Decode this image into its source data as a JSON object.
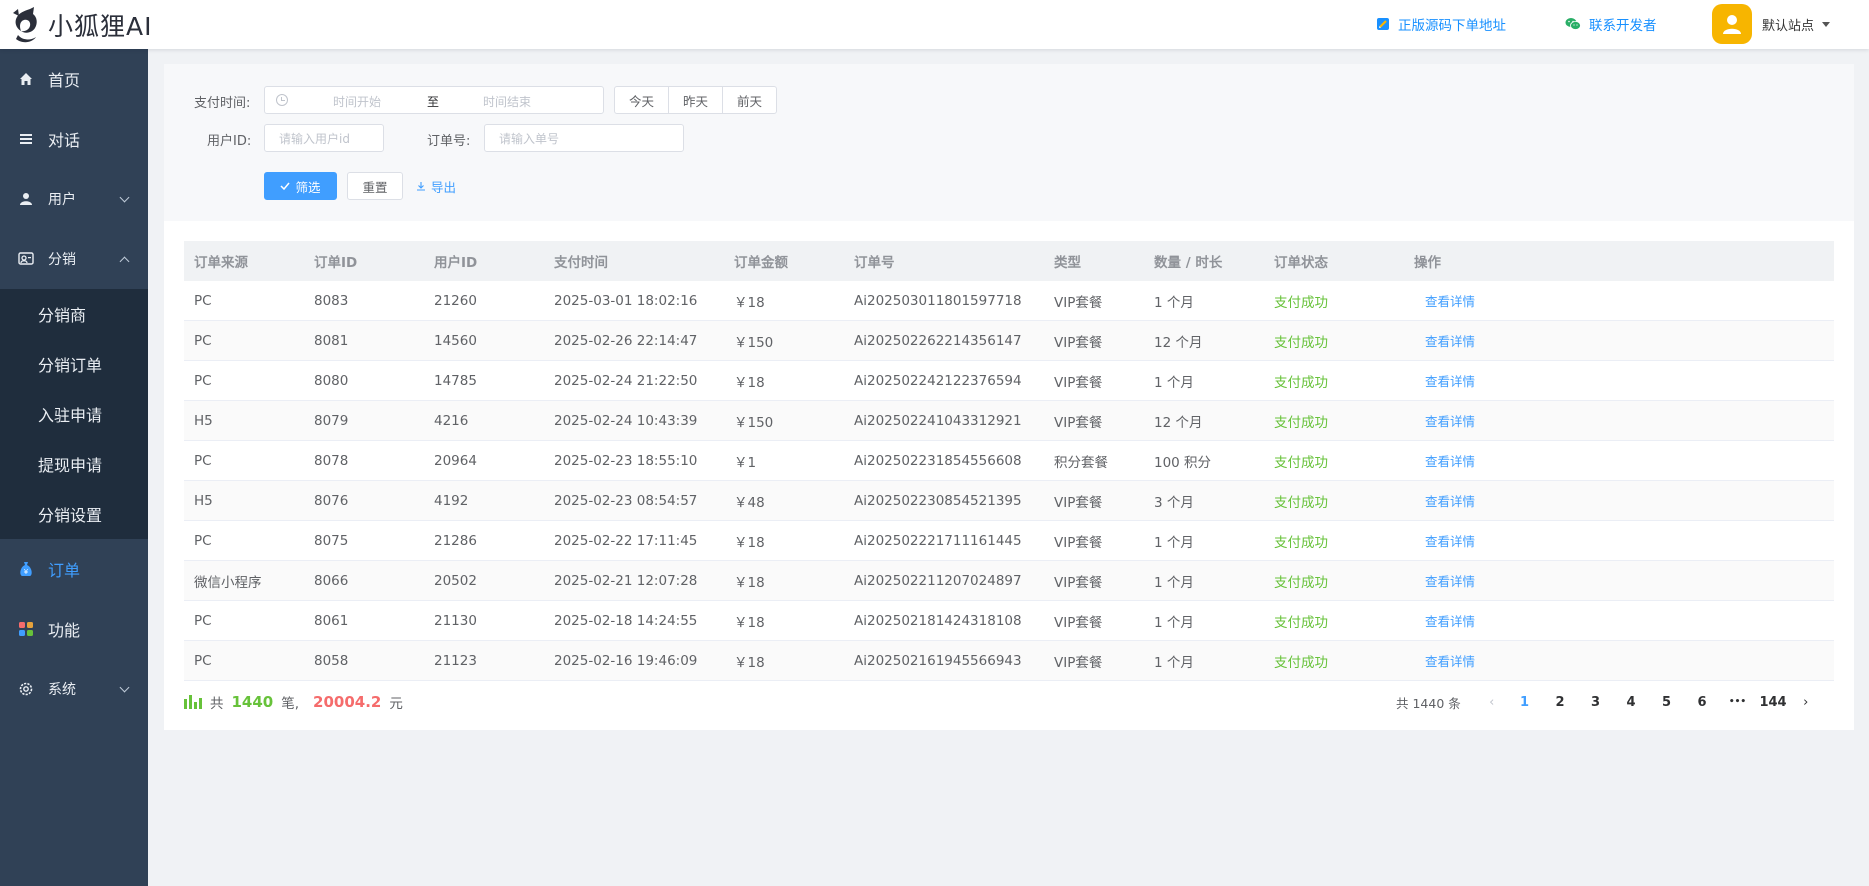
{
  "header": {
    "logo_text": "小狐狸AI",
    "link_source": "正版源码下单地址",
    "link_dev": "联系开发者",
    "user_name": "默认站点"
  },
  "sidebar": {
    "items": [
      {
        "label": "首页",
        "icon": "home-icon"
      },
      {
        "label": "对话",
        "icon": "list-icon"
      },
      {
        "label": "用户",
        "icon": "user-icon"
      },
      {
        "label": "分销",
        "icon": "share-icon"
      },
      {
        "label": "订单",
        "icon": "money-bag-icon"
      },
      {
        "label": "功能",
        "icon": "apps-icon"
      },
      {
        "label": "系统",
        "icon": "gear-icon"
      }
    ],
    "sub_items": [
      "分销商",
      "分销订单",
      "入驻申请",
      "提现申请",
      "分销设置"
    ]
  },
  "filter": {
    "pay_time_label": "支付时间:",
    "start_placeholder": "时间开始",
    "range_sep": "至",
    "end_placeholder": "时间结束",
    "quick": [
      "今天",
      "昨天",
      "前天"
    ],
    "user_id_label": "用户ID:",
    "user_id_placeholder": "请输入用户id",
    "order_no_label": "订单号:",
    "order_no_placeholder": "请输入单号",
    "filter_btn": "筛选",
    "reset_btn": "重置",
    "export_btn": "导出"
  },
  "table": {
    "headers": [
      "订单来源",
      "订单ID",
      "用户ID",
      "支付时间",
      "订单金额",
      "订单号",
      "类型",
      "数量 / 时长",
      "订单状态",
      "操作"
    ],
    "rows": [
      [
        "PC",
        "8083",
        "21260",
        "2025-03-01 18:02:16",
        "￥18",
        "Ai202503011801597718",
        "VIP套餐",
        "1 个月",
        "支付成功",
        "查看详情"
      ],
      [
        "PC",
        "8081",
        "14560",
        "2025-02-26 22:14:47",
        "￥150",
        "Ai202502262214356147",
        "VIP套餐",
        "12 个月",
        "支付成功",
        "查看详情"
      ],
      [
        "PC",
        "8080",
        "14785",
        "2025-02-24 21:22:50",
        "￥18",
        "Ai202502242122376594",
        "VIP套餐",
        "1 个月",
        "支付成功",
        "查看详情"
      ],
      [
        "H5",
        "8079",
        "4216",
        "2025-02-24 10:43:39",
        "￥150",
        "Ai202502241043312921",
        "VIP套餐",
        "12 个月",
        "支付成功",
        "查看详情"
      ],
      [
        "PC",
        "8078",
        "20964",
        "2025-02-23 18:55:10",
        "￥1",
        "Ai202502231854556608",
        "积分套餐",
        "100 积分",
        "支付成功",
        "查看详情"
      ],
      [
        "H5",
        "8076",
        "4192",
        "2025-02-23 08:54:57",
        "￥48",
        "Ai202502230854521395",
        "VIP套餐",
        "3 个月",
        "支付成功",
        "查看详情"
      ],
      [
        "PC",
        "8075",
        "21286",
        "2025-02-22 17:11:45",
        "￥18",
        "Ai202502221711161445",
        "VIP套餐",
        "1 个月",
        "支付成功",
        "查看详情"
      ],
      [
        "微信小程序",
        "8066",
        "20502",
        "2025-02-21 12:07:28",
        "￥18",
        "Ai202502211207024897",
        "VIP套餐",
        "1 个月",
        "支付成功",
        "查看详情"
      ],
      [
        "PC",
        "8061",
        "21130",
        "2025-02-18 14:24:55",
        "￥18",
        "Ai202502181424318108",
        "VIP套餐",
        "1 个月",
        "支付成功",
        "查看详情"
      ],
      [
        "PC",
        "8058",
        "21123",
        "2025-02-16 19:46:09",
        "￥18",
        "Ai202502161945566943",
        "VIP套餐",
        "1 个月",
        "支付成功",
        "查看详情"
      ]
    ]
  },
  "summary": {
    "prefix": "共",
    "count": "1440",
    "count_unit": "笔,",
    "amount": "20004.2",
    "amount_unit": "元"
  },
  "pagination": {
    "total_text": "共 1440 条",
    "pages": [
      "1",
      "2",
      "3",
      "4",
      "5",
      "6"
    ],
    "ellipsis": "•••",
    "last": "144",
    "current": "1"
  },
  "colors": {
    "sidebar_bg": "#304156",
    "submenu_bg": "#1f2d3d",
    "primary": "#409eff",
    "success": "#67c23a",
    "danger": "#f56c6c"
  }
}
